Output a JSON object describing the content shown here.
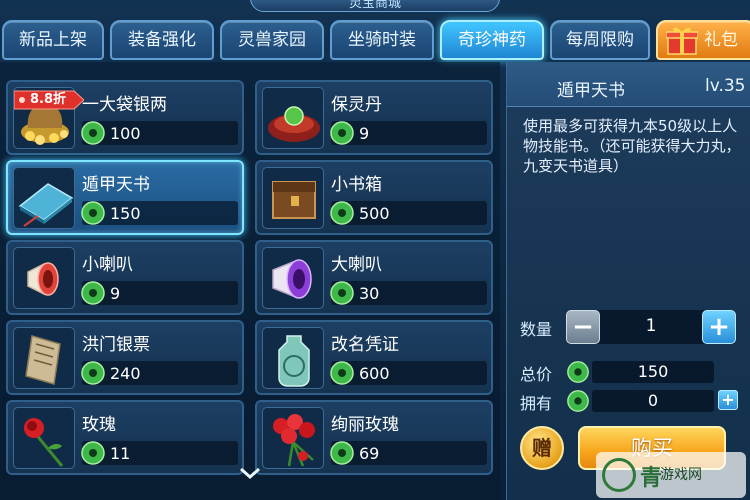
{
  "header": {
    "title": "灵宝商城"
  },
  "tabs": [
    {
      "label": "新品上架"
    },
    {
      "label": "装备强化"
    },
    {
      "label": "灵兽家园"
    },
    {
      "label": "坐骑时装"
    },
    {
      "label": "奇珍神药",
      "active": true
    },
    {
      "label": "每周限购"
    },
    {
      "label": "礼包"
    }
  ],
  "items": [
    {
      "name": "一大袋银两",
      "price": "100",
      "badge": "8.8折",
      "icon": "silver-bag-icon"
    },
    {
      "name": "保灵丹",
      "price": "9",
      "icon": "pill-icon"
    },
    {
      "name": "遁甲天书",
      "price": "150",
      "selected": true,
      "icon": "book-icon"
    },
    {
      "name": "小书箱",
      "price": "500",
      "icon": "chest-icon"
    },
    {
      "name": "小喇叭",
      "price": "9",
      "icon": "small-horn-icon"
    },
    {
      "name": "大喇叭",
      "price": "30",
      "icon": "big-horn-icon"
    },
    {
      "name": "洪门银票",
      "price": "240",
      "icon": "banknote-icon"
    },
    {
      "name": "改名凭证",
      "price": "600",
      "icon": "rename-token-icon"
    },
    {
      "name": "玫瑰",
      "price": "11",
      "icon": "rose-icon"
    },
    {
      "name": "绚丽玫瑰",
      "price": "69",
      "icon": "bouquet-icon"
    }
  ],
  "detail": {
    "name": "遁甲天书",
    "level": "lv.35",
    "description": "使用最多可获得九本50级以上人物技能书。（还可能获得大力丸，九变天书道具）",
    "quantity_label": "数量",
    "quantity": "1",
    "total_label": "总价",
    "total": "150",
    "owned_label": "拥有",
    "owned": "0",
    "gift_label": "赠",
    "buy_label": "购买"
  },
  "watermark": {
    "text": "青",
    "small": "游戏网"
  },
  "colors": {
    "accent": "#42c6ff",
    "gold": "#f7a51c",
    "jade": "#4cc04a"
  }
}
